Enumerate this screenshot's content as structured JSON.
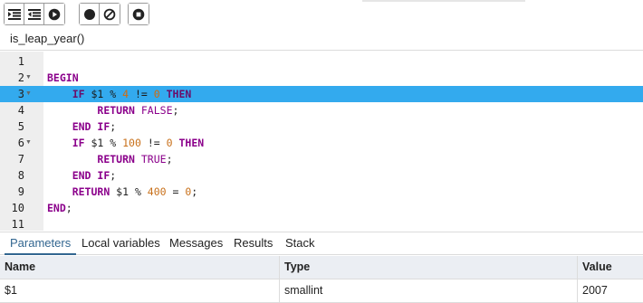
{
  "toolbar": {
    "buttons": [
      {
        "icon": "step-into-icon"
      },
      {
        "icon": "step-over-icon"
      },
      {
        "icon": "continue-icon"
      },
      {
        "icon": "toggle-breakpoint-icon"
      },
      {
        "icon": "clear-breakpoints-icon"
      },
      {
        "icon": "stop-icon"
      }
    ]
  },
  "function_name": "is_leap_year()",
  "editor": {
    "active_line": 3,
    "lines": [
      {
        "num": "1"
      },
      {
        "num": "2",
        "fold": "▼"
      },
      {
        "num": "3",
        "fold": "▼"
      },
      {
        "num": "4"
      },
      {
        "num": "5"
      },
      {
        "num": "6",
        "fold": "▼"
      },
      {
        "num": "7"
      },
      {
        "num": "8"
      },
      {
        "num": "9"
      },
      {
        "num": "10"
      },
      {
        "num": "11"
      }
    ],
    "code": {
      "l2": "BEGIN",
      "l3": [
        "IF",
        " $1 % ",
        "4",
        " != ",
        "0",
        " ",
        "THEN"
      ],
      "l4": [
        "RETURN",
        " ",
        "FALSE",
        ";"
      ],
      "l5": [
        "END IF",
        ";"
      ],
      "l6": [
        "IF",
        " $1 % ",
        "100",
        " != ",
        "0",
        " ",
        "THEN"
      ],
      "l7": [
        "RETURN",
        " ",
        "TRUE",
        ";"
      ],
      "l8": [
        "END IF",
        ";"
      ],
      "l9": [
        "RETURN",
        " $1 % ",
        "400",
        " = ",
        "0",
        ";"
      ],
      "l10": [
        "END",
        ";"
      ]
    }
  },
  "tabs": [
    {
      "label": "Parameters",
      "active": true
    },
    {
      "label": "Local variables"
    },
    {
      "label": "Messages"
    },
    {
      "label": "Results"
    },
    {
      "label": "Stack"
    }
  ],
  "grid": {
    "columns": [
      "Name",
      "Type",
      "Value"
    ],
    "rows": [
      [
        "$1",
        "smallint",
        "2007"
      ]
    ]
  },
  "colors": {
    "active_line": "#33aaee",
    "keyword": "#8b008b",
    "number": "#c8701a",
    "tab_active": "#326690",
    "gutter": "#eeeeee",
    "grid_header": "#ebeef3"
  }
}
